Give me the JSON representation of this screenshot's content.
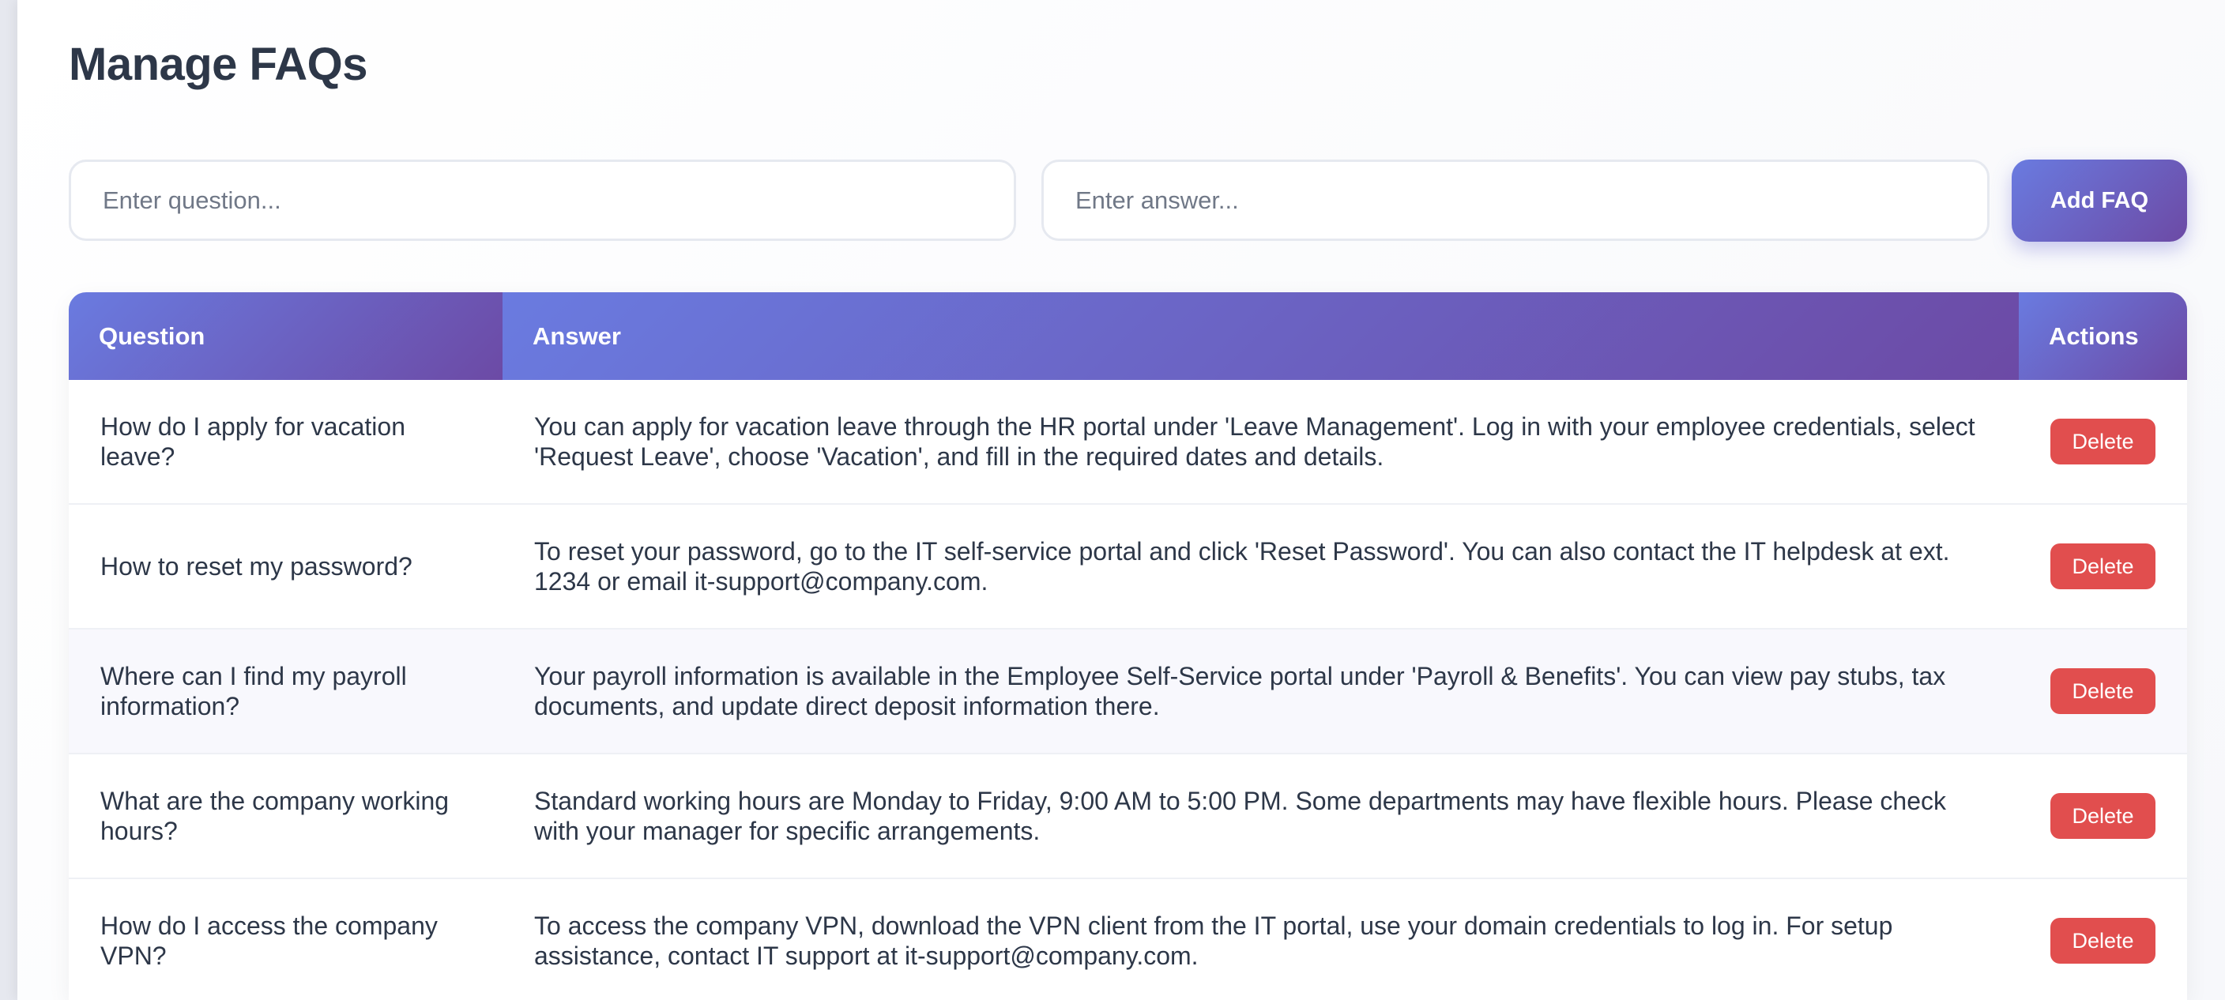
{
  "page": {
    "title": "Manage FAQs"
  },
  "form": {
    "question_placeholder": "Enter question...",
    "answer_placeholder": "Enter answer...",
    "add_label": "Add FAQ"
  },
  "table": {
    "headers": {
      "question": "Question",
      "answer": "Answer",
      "actions": "Actions"
    },
    "delete_label": "Delete",
    "rows": [
      {
        "question": "How do I apply for vacation leave?",
        "answer": "You can apply for vacation leave through the HR portal under 'Leave Management'. Log in with your employee credentials, select 'Request Leave', choose 'Vacation', and fill in the required dates and details."
      },
      {
        "question": "How to reset my password?",
        "answer": "To reset your password, go to the IT self-service portal and click 'Reset Password'. You can also contact the IT helpdesk at ext. 1234 or email it-support@company.com."
      },
      {
        "question": "Where can I find my payroll information?",
        "answer": "Your payroll information is available in the Employee Self-Service portal under 'Payroll & Benefits'. You can view pay stubs, tax documents, and update direct deposit information there."
      },
      {
        "question": "What are the company working hours?",
        "answer": "Standard working hours are Monday to Friday, 9:00 AM to 5:00 PM. Some departments may have flexible hours. Please check with your manager for specific arrangements."
      },
      {
        "question": "How do I access the company VPN?",
        "answer": "To access the company VPN, download the VPN client from the IT portal, use your domain credentials to log in. For setup assistance, contact IT support at it-support@company.com."
      }
    ]
  },
  "colors": {
    "accent_start": "#6a7be0",
    "accent_end": "#6c4aa5",
    "delete": "#e14e4e",
    "text": "#2d3748"
  }
}
